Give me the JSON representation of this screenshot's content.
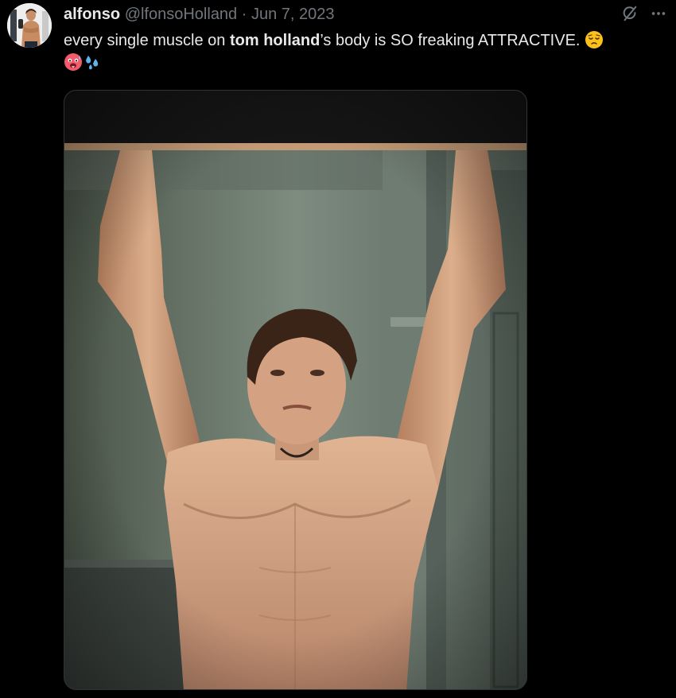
{
  "tweet": {
    "author_name": "alfonso",
    "author_handle": "@lfonsoHolland",
    "separator": "·",
    "date": "Jun 7, 2023",
    "text_before": "every single muscle on ",
    "text_bold": "tom holland",
    "text_after": "’s body is SO freaking ATTRACTIVE.",
    "emojis": [
      "relieved-face-emoji",
      "hot-face-emoji",
      "sweat-droplets-emoji"
    ]
  },
  "icons": {
    "grok": "grok-icon",
    "more": "more-icon"
  },
  "colors": {
    "background": "#000000",
    "primary_text": "#e7e9ea",
    "secondary_text": "#71767b",
    "media_border": "#2f3336"
  }
}
